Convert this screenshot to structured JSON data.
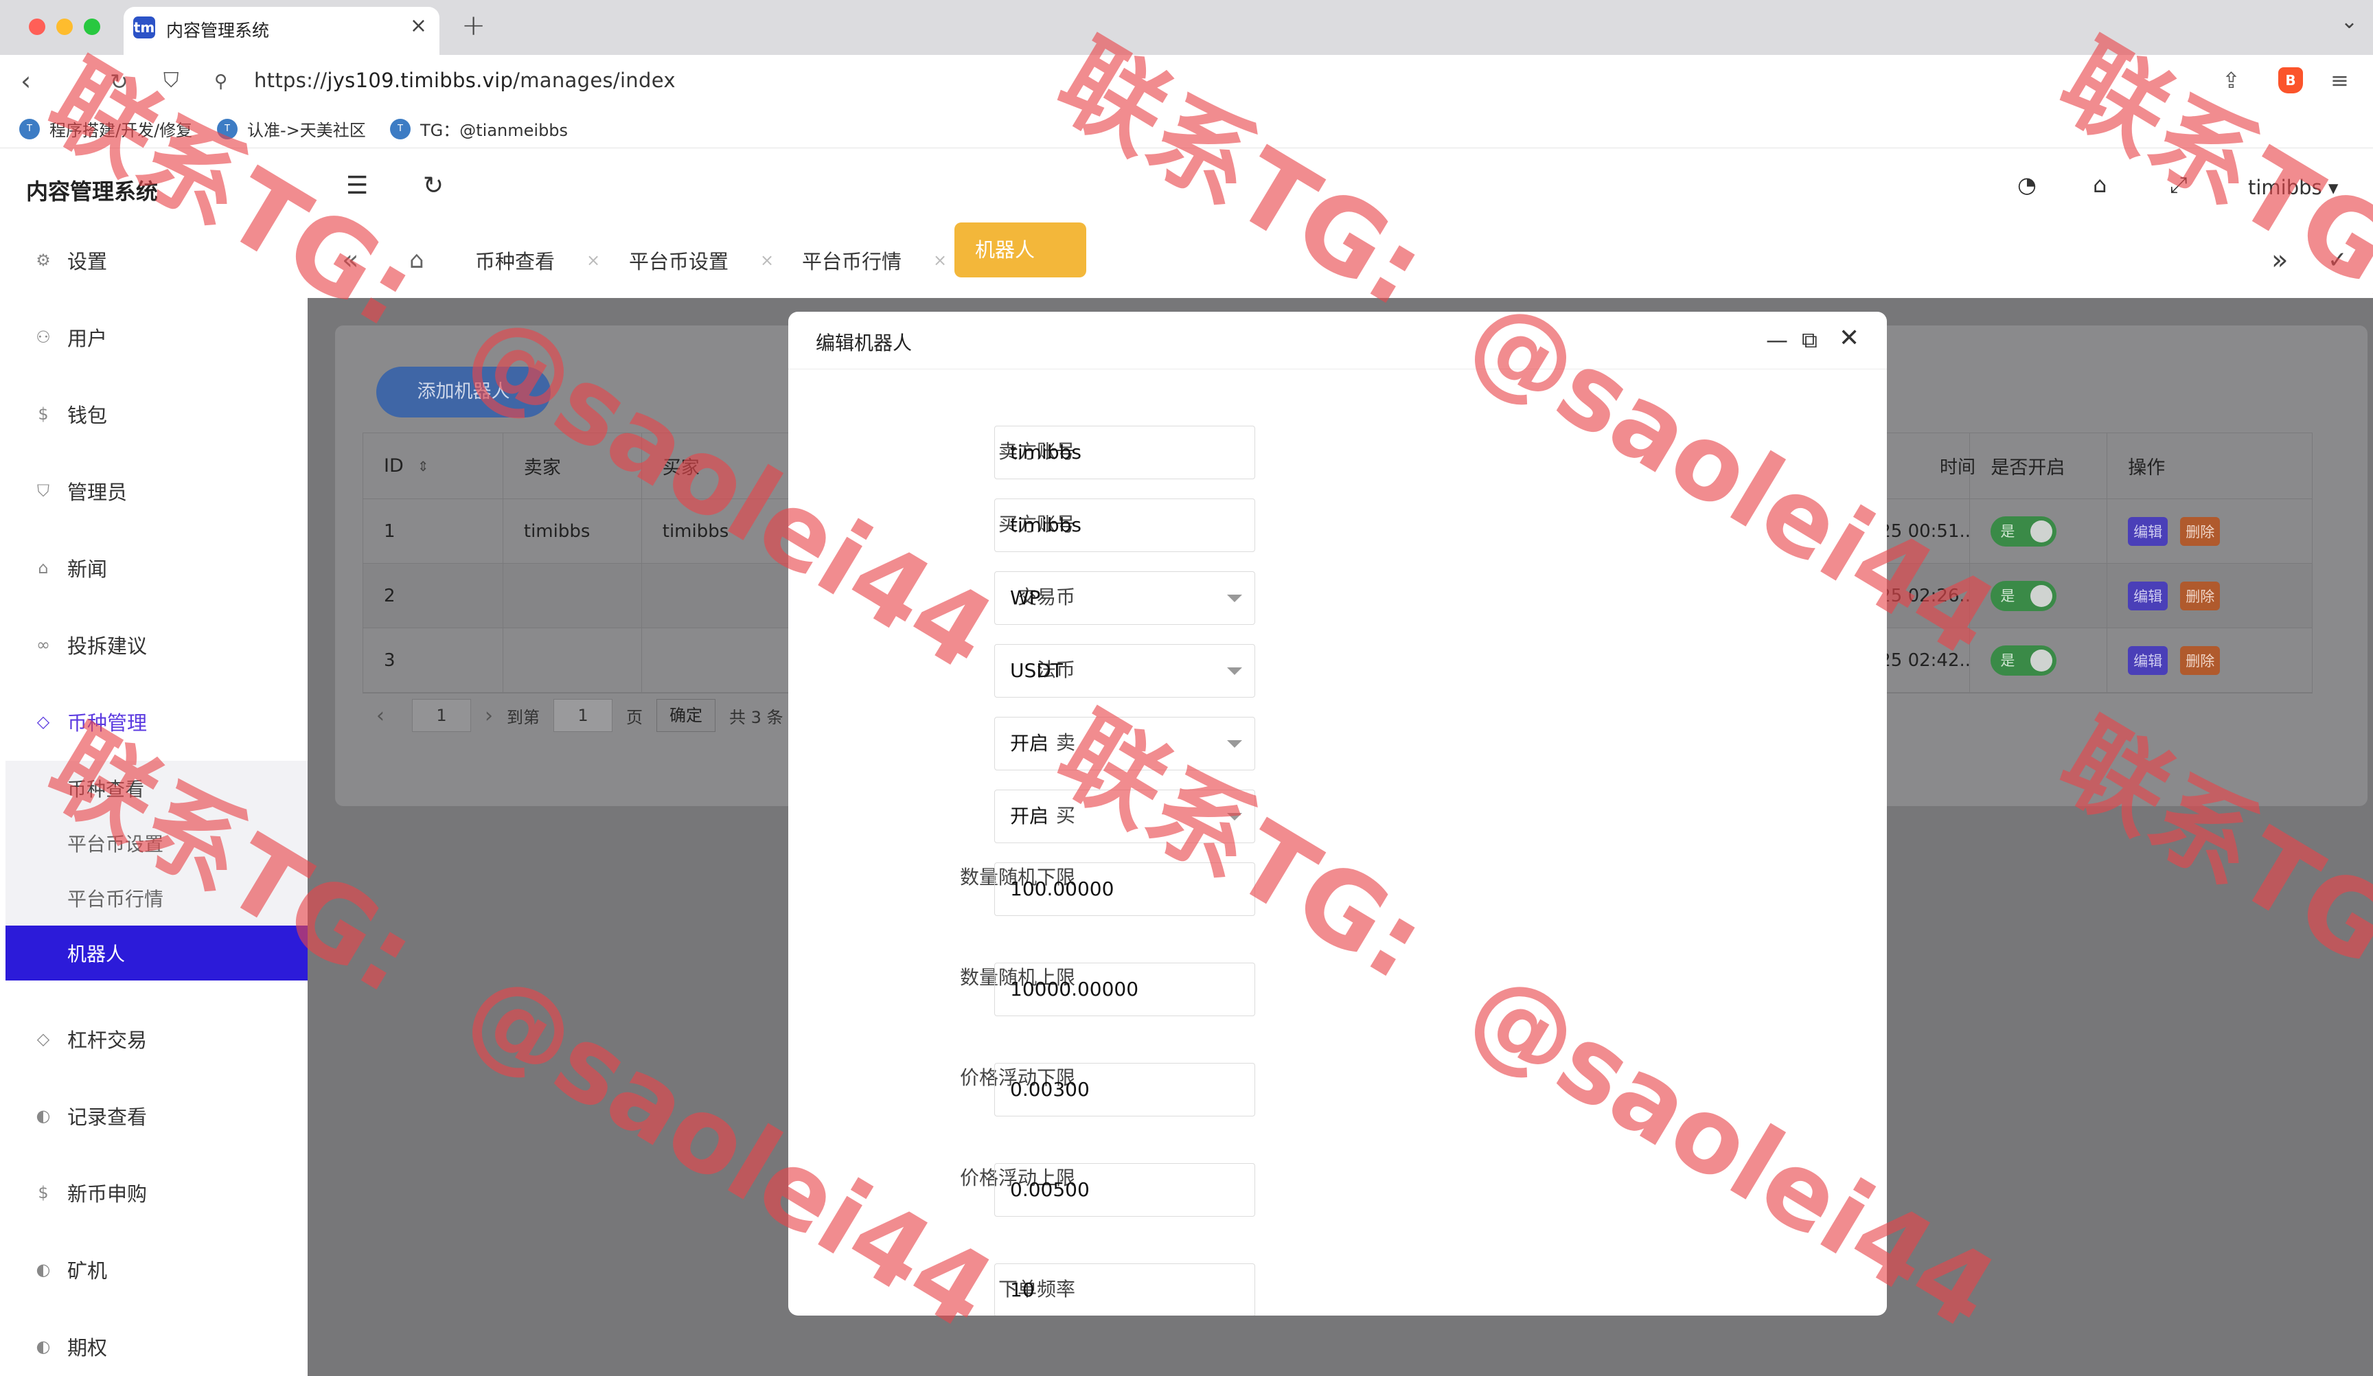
{
  "browser": {
    "tab_title": "内容管理系统",
    "tab_favicon": "tm",
    "url_protocol": "https://",
    "url_host": "jys109.timibbs.vip",
    "url_path": "/manages/index",
    "bookmarks": [
      "程序搭建/开发/修复",
      "认准->天美社区",
      "TG：@tianmeibbs"
    ]
  },
  "app": {
    "title": "内容管理系统",
    "user": "timibbs ▾"
  },
  "tabs": [
    {
      "label": "币种查看"
    },
    {
      "label": "平台币设置"
    },
    {
      "label": "平台币行情"
    },
    {
      "label": "机器人"
    }
  ],
  "sidebar": {
    "items": [
      {
        "label": "设置",
        "icon": "gear-icon",
        "glyph": "⚙"
      },
      {
        "label": "用户",
        "icon": "user-icon",
        "glyph": "⚇"
      },
      {
        "label": "钱包",
        "icon": "dollar-icon",
        "glyph": "$"
      },
      {
        "label": "管理员",
        "icon": "shield-icon",
        "glyph": "⛉"
      },
      {
        "label": "新闻",
        "icon": "tag-icon",
        "glyph": "⌂"
      },
      {
        "label": "投拆建议",
        "icon": "link-icon",
        "glyph": "∞"
      },
      {
        "label": "币种管理",
        "icon": "diamond-icon",
        "glyph": "◇"
      },
      {
        "label": "杠杆交易",
        "icon": "diamond-icon",
        "glyph": "◇"
      },
      {
        "label": "记录查看",
        "icon": "record-icon",
        "glyph": "◐"
      },
      {
        "label": "新币申购",
        "icon": "dollar-icon",
        "glyph": "$"
      },
      {
        "label": "矿机",
        "icon": "record-icon",
        "glyph": "◐"
      },
      {
        "label": "期权",
        "icon": "record-icon",
        "glyph": "◐"
      }
    ],
    "sub_items": [
      "币种查看",
      "平台币设置",
      "平台币行情",
      "机器人"
    ]
  },
  "page": {
    "add_button": "添加机器人",
    "columns": {
      "id": "ID",
      "seller": "卖家",
      "buyer": "买家",
      "time": "时间",
      "enabled": "是否开启",
      "ops": "操作"
    },
    "rows": [
      {
        "id": "1",
        "seller": "timibbs",
        "buyer": "timibbs",
        "time": "07-25 00:51...",
        "enabled": "是"
      },
      {
        "id": "2",
        "seller": "",
        "buyer": "",
        "time": "07-25 02:26...",
        "enabled": "是"
      },
      {
        "id": "3",
        "seller": "",
        "buyer": "",
        "time": "07-25 02:42...",
        "enabled": "是"
      }
    ],
    "edit_label": "编辑",
    "delete_label": "删除",
    "pager": {
      "current": "1",
      "goto_label": "到第",
      "goto_value": "1",
      "page_unit": "页",
      "confirm": "确定",
      "total": "共 3 条"
    }
  },
  "modal": {
    "title": "编辑机器人",
    "fields": [
      {
        "label": "卖方账号",
        "value": "timibbs",
        "type": "text"
      },
      {
        "label": "买方账号",
        "value": "timibbs",
        "type": "text"
      },
      {
        "label": "交易币",
        "value": "WP",
        "type": "select"
      },
      {
        "label": "法币",
        "value": "USDT",
        "type": "select"
      },
      {
        "label": "卖",
        "value": "开启",
        "type": "select"
      },
      {
        "label": "买",
        "value": "开启",
        "type": "select"
      },
      {
        "label": "数量随机下限",
        "value": "100.00000",
        "type": "text"
      },
      {
        "label": "数量随机上限",
        "value": "10000.00000",
        "type": "text"
      },
      {
        "label": "价格浮动下限",
        "value": "0.00300",
        "type": "text"
      },
      {
        "label": "价格浮动上限",
        "value": "0.00500",
        "type": "text"
      },
      {
        "label": "下单频率",
        "value": "10",
        "type": "text"
      }
    ]
  },
  "watermark": {
    "tg": "联系TG:",
    "handle": "@saolei44"
  }
}
